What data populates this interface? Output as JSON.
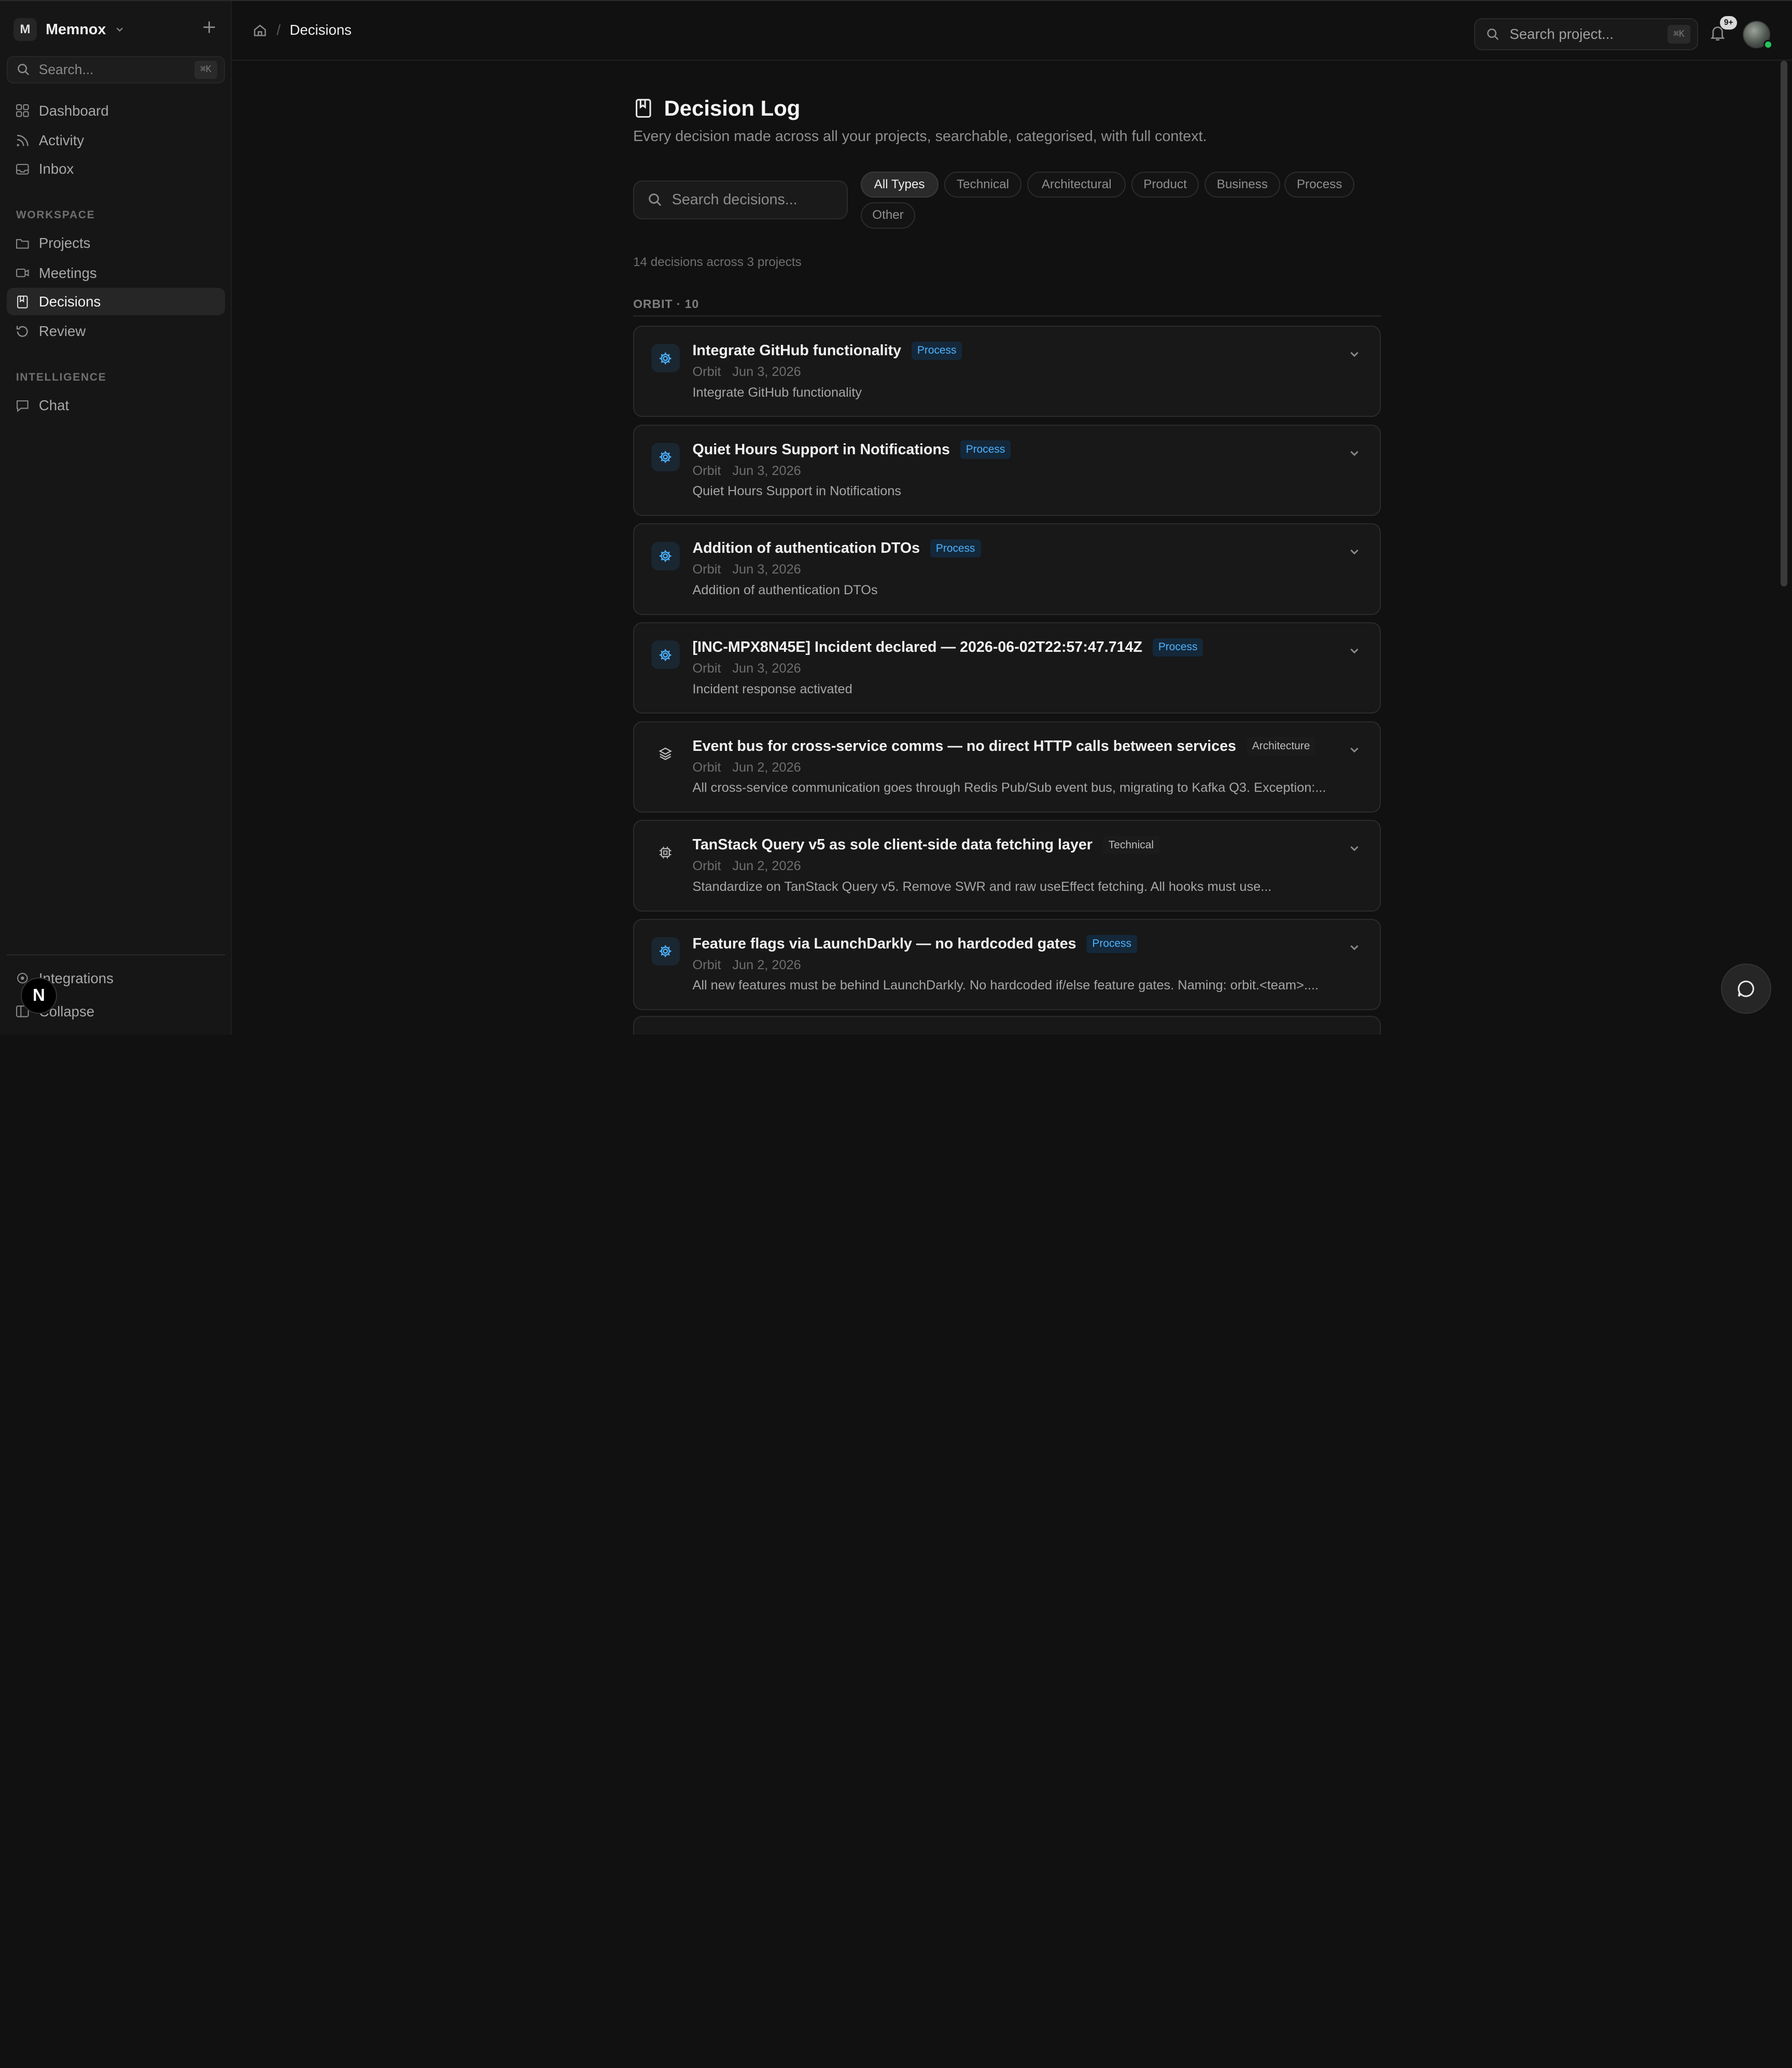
{
  "workspace": {
    "initial": "M",
    "name": "Memnox"
  },
  "sidebar": {
    "search_placeholder": "Search...",
    "search_shortcut": "⌘K",
    "primary": [
      {
        "label": "Dashboard",
        "icon": "grid-icon"
      },
      {
        "label": "Activity",
        "icon": "rss-icon"
      },
      {
        "label": "Inbox",
        "icon": "inbox-icon"
      }
    ],
    "workspace_label": "WORKSPACE",
    "workspace_items": [
      {
        "label": "Projects",
        "icon": "folder-icon"
      },
      {
        "label": "Meetings",
        "icon": "video-icon"
      },
      {
        "label": "Decisions",
        "icon": "bookmark-icon",
        "active": true
      },
      {
        "label": "Review",
        "icon": "refresh-icon"
      }
    ],
    "intelligence_label": "INTELLIGENCE",
    "intelligence_items": [
      {
        "label": "Chat",
        "icon": "chat-icon"
      }
    ],
    "footer": [
      {
        "label": "Integrations",
        "icon": "plug-icon"
      },
      {
        "label": "Collapse",
        "icon": "collapse-icon"
      }
    ],
    "fab_letter": "N"
  },
  "topbar": {
    "breadcrumb_current": "Decisions",
    "search_placeholder": "Search project...",
    "search_shortcut": "⌘K",
    "notifications_badge": "9+"
  },
  "page": {
    "title": "Decision Log",
    "subtitle": "Every decision made across all your projects, searchable, categorised, with full context.",
    "search_placeholder": "Search decisions...",
    "filters": [
      "All Types",
      "Technical",
      "Architectural",
      "Product",
      "Business",
      "Process",
      "Other"
    ],
    "active_filter": "All Types",
    "count_text": "14 decisions across 3 projects",
    "group_label": "ORBIT · 10"
  },
  "decisions": [
    {
      "title": "Integrate GitHub functionality",
      "tag": "Process",
      "project": "Orbit",
      "date": "Jun 3, 2026",
      "description": "Integrate GitHub functionality",
      "icon": "gear-icon"
    },
    {
      "title": "Quiet Hours Support in Notifications",
      "tag": "Process",
      "project": "Orbit",
      "date": "Jun 3, 2026",
      "description": "Quiet Hours Support in Notifications",
      "icon": "gear-icon"
    },
    {
      "title": "Addition of authentication DTOs",
      "tag": "Process",
      "project": "Orbit",
      "date": "Jun 3, 2026",
      "description": "Addition of authentication DTOs",
      "icon": "gear-icon"
    },
    {
      "title": "[INC-MPX8N45E] Incident declared — 2026-06-02T22:57:47.714Z",
      "tag": "Process",
      "project": "Orbit",
      "date": "Jun 3, 2026",
      "description": "Incident response activated",
      "icon": "gear-icon"
    },
    {
      "title": "Event bus for cross-service comms — no direct HTTP calls between services",
      "tag": "Architecture",
      "project": "Orbit",
      "date": "Jun 2, 2026",
      "description": "All cross-service communication goes through Redis Pub/Sub event bus, migrating to Kafka Q3. Exception:...",
      "icon": "layers-icon"
    },
    {
      "title": "TanStack Query v5 as sole client-side data fetching layer",
      "tag": "Technical",
      "project": "Orbit",
      "date": "Jun 2, 2026",
      "description": "Standardize on TanStack Query v5. Remove SWR and raw useEffect fetching. All hooks must use...",
      "icon": "cpu-icon"
    },
    {
      "title": "Feature flags via LaunchDarkly — no hardcoded gates",
      "tag": "Process",
      "project": "Orbit",
      "date": "Jun 2, 2026",
      "description": "All new features must be behind LaunchDarkly. No hardcoded if/else feature gates. Naming: orbit.<team>....",
      "icon": "gear-icon"
    }
  ],
  "colors": {
    "background": "#111111",
    "sidebar": "#161616",
    "card": "#181818",
    "process_tag_text": "#4db2ff",
    "process_tag_bg": "#14283a",
    "online_dot": "#22c55e"
  }
}
